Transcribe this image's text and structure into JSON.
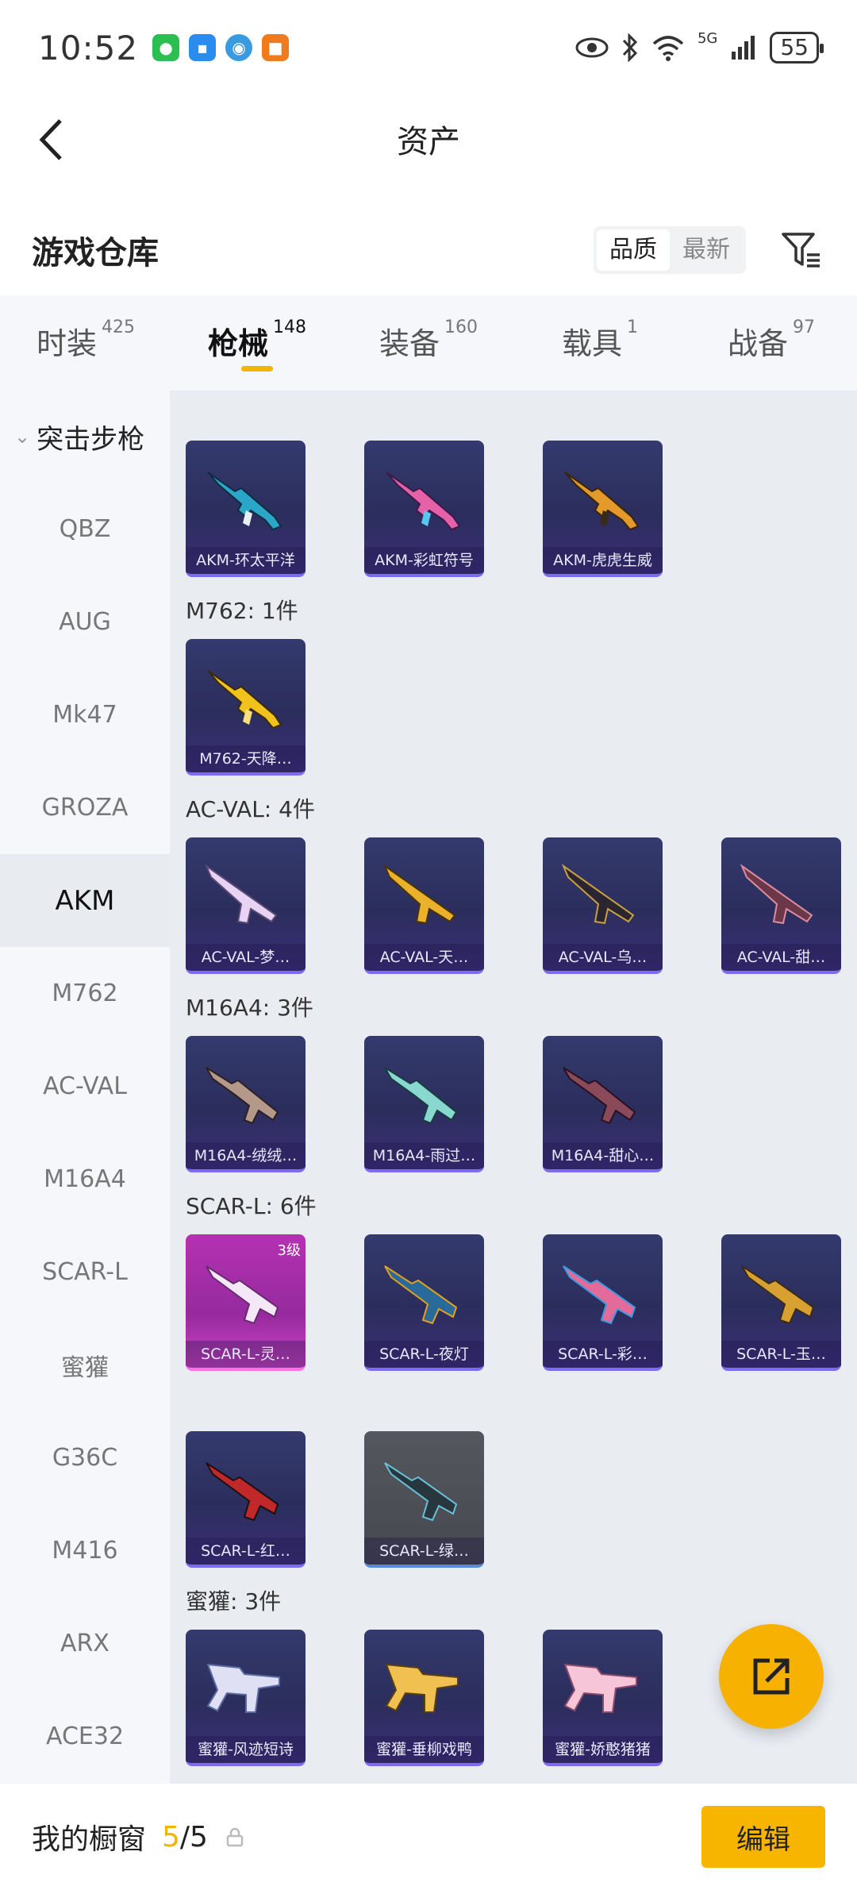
{
  "status_bar": {
    "time": "10:52",
    "battery": "55",
    "network": "5G",
    "icons": [
      "eye-icon",
      "bluetooth-icon",
      "wifi-icon",
      "signal-icon",
      "battery-icon"
    ]
  },
  "header": {
    "title": "资产"
  },
  "section": {
    "title": "游戏仓库",
    "sort_options": [
      "品质",
      "最新"
    ],
    "sort_selected": "品质"
  },
  "tabs": [
    {
      "label": "时装",
      "count": "425"
    },
    {
      "label": "枪械",
      "count": "148",
      "active": true
    },
    {
      "label": "装备",
      "count": "160"
    },
    {
      "label": "载具",
      "count": "1"
    },
    {
      "label": "战备",
      "count": "97"
    }
  ],
  "sidebar": {
    "group": "突击步枪",
    "items": [
      "QBZ",
      "AUG",
      "Mk47",
      "GROZA",
      "AKM",
      "M762",
      "AC-VAL",
      "M16A4",
      "SCAR-L",
      "蜜獾",
      "G36C",
      "M416",
      "ARX",
      "ACE32"
    ],
    "active": "AKM"
  },
  "groups": {
    "akm_items": [
      "AKM-环太平洋",
      "AKM-彩虹符号",
      "AKM-虎虎生威"
    ],
    "m762_label": "M762: 1件",
    "m762_items": [
      "M762-天降…"
    ],
    "acval_label": "AC-VAL: 4件",
    "acval_items": [
      "AC-VAL-梦…",
      "AC-VAL-天…",
      "AC-VAL-乌…",
      "AC-VAL-甜…"
    ],
    "m16_label": "M16A4: 3件",
    "m16_items": [
      "M16A4-绒绒…",
      "M16A4-雨过…",
      "M16A4-甜心…"
    ],
    "scar_label": "SCAR-L: 6件",
    "scar_items": [
      "SCAR-L-灵…",
      "SCAR-L-夜灯",
      "SCAR-L-彩…",
      "SCAR-L-玉…",
      "SCAR-L-红…",
      "SCAR-L-绿…"
    ],
    "scar_level": "3级",
    "honey_label": "蜜獾: 3件",
    "honey_items": [
      "蜜獾-风迹短诗",
      "蜜獾-垂柳戏鸭",
      "蜜獾-娇憨猪猪"
    ]
  },
  "bottom": {
    "label": "我的橱窗",
    "count_current": "5",
    "count_total": "/5",
    "edit_label": "编辑"
  },
  "colors": {
    "accent": "#f5b400",
    "card_purple": "#2f325f",
    "card_pink": "#b531b3",
    "card_gray": "#4e5057"
  }
}
